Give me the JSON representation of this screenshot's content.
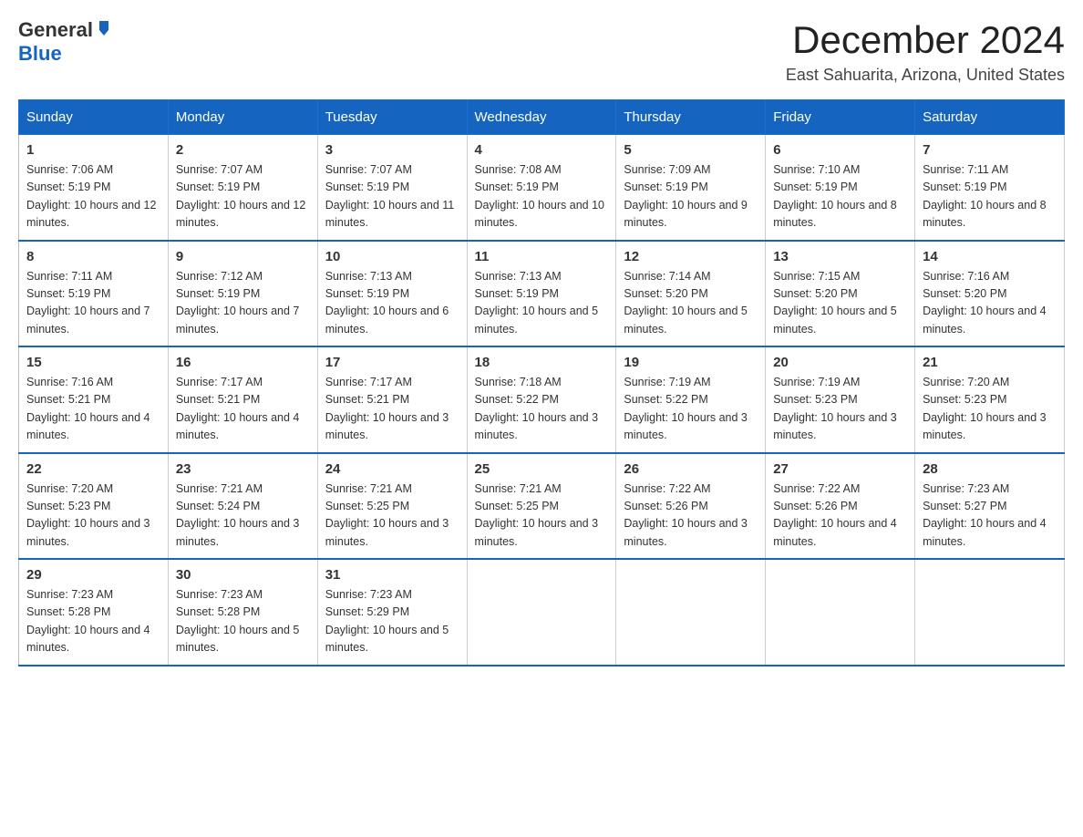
{
  "header": {
    "logo_general": "General",
    "logo_blue": "Blue",
    "title": "December 2024",
    "location": "East Sahuarita, Arizona, United States"
  },
  "days_of_week": [
    "Sunday",
    "Monday",
    "Tuesday",
    "Wednesday",
    "Thursday",
    "Friday",
    "Saturday"
  ],
  "weeks": [
    [
      {
        "day": "1",
        "sunrise": "7:06 AM",
        "sunset": "5:19 PM",
        "daylight": "10 hours and 12 minutes."
      },
      {
        "day": "2",
        "sunrise": "7:07 AM",
        "sunset": "5:19 PM",
        "daylight": "10 hours and 12 minutes."
      },
      {
        "day": "3",
        "sunrise": "7:07 AM",
        "sunset": "5:19 PM",
        "daylight": "10 hours and 11 minutes."
      },
      {
        "day": "4",
        "sunrise": "7:08 AM",
        "sunset": "5:19 PM",
        "daylight": "10 hours and 10 minutes."
      },
      {
        "day": "5",
        "sunrise": "7:09 AM",
        "sunset": "5:19 PM",
        "daylight": "10 hours and 9 minutes."
      },
      {
        "day": "6",
        "sunrise": "7:10 AM",
        "sunset": "5:19 PM",
        "daylight": "10 hours and 8 minutes."
      },
      {
        "day": "7",
        "sunrise": "7:11 AM",
        "sunset": "5:19 PM",
        "daylight": "10 hours and 8 minutes."
      }
    ],
    [
      {
        "day": "8",
        "sunrise": "7:11 AM",
        "sunset": "5:19 PM",
        "daylight": "10 hours and 7 minutes."
      },
      {
        "day": "9",
        "sunrise": "7:12 AM",
        "sunset": "5:19 PM",
        "daylight": "10 hours and 7 minutes."
      },
      {
        "day": "10",
        "sunrise": "7:13 AM",
        "sunset": "5:19 PM",
        "daylight": "10 hours and 6 minutes."
      },
      {
        "day": "11",
        "sunrise": "7:13 AM",
        "sunset": "5:19 PM",
        "daylight": "10 hours and 5 minutes."
      },
      {
        "day": "12",
        "sunrise": "7:14 AM",
        "sunset": "5:20 PM",
        "daylight": "10 hours and 5 minutes."
      },
      {
        "day": "13",
        "sunrise": "7:15 AM",
        "sunset": "5:20 PM",
        "daylight": "10 hours and 5 minutes."
      },
      {
        "day": "14",
        "sunrise": "7:16 AM",
        "sunset": "5:20 PM",
        "daylight": "10 hours and 4 minutes."
      }
    ],
    [
      {
        "day": "15",
        "sunrise": "7:16 AM",
        "sunset": "5:21 PM",
        "daylight": "10 hours and 4 minutes."
      },
      {
        "day": "16",
        "sunrise": "7:17 AM",
        "sunset": "5:21 PM",
        "daylight": "10 hours and 4 minutes."
      },
      {
        "day": "17",
        "sunrise": "7:17 AM",
        "sunset": "5:21 PM",
        "daylight": "10 hours and 3 minutes."
      },
      {
        "day": "18",
        "sunrise": "7:18 AM",
        "sunset": "5:22 PM",
        "daylight": "10 hours and 3 minutes."
      },
      {
        "day": "19",
        "sunrise": "7:19 AM",
        "sunset": "5:22 PM",
        "daylight": "10 hours and 3 minutes."
      },
      {
        "day": "20",
        "sunrise": "7:19 AM",
        "sunset": "5:23 PM",
        "daylight": "10 hours and 3 minutes."
      },
      {
        "day": "21",
        "sunrise": "7:20 AM",
        "sunset": "5:23 PM",
        "daylight": "10 hours and 3 minutes."
      }
    ],
    [
      {
        "day": "22",
        "sunrise": "7:20 AM",
        "sunset": "5:23 PM",
        "daylight": "10 hours and 3 minutes."
      },
      {
        "day": "23",
        "sunrise": "7:21 AM",
        "sunset": "5:24 PM",
        "daylight": "10 hours and 3 minutes."
      },
      {
        "day": "24",
        "sunrise": "7:21 AM",
        "sunset": "5:25 PM",
        "daylight": "10 hours and 3 minutes."
      },
      {
        "day": "25",
        "sunrise": "7:21 AM",
        "sunset": "5:25 PM",
        "daylight": "10 hours and 3 minutes."
      },
      {
        "day": "26",
        "sunrise": "7:22 AM",
        "sunset": "5:26 PM",
        "daylight": "10 hours and 3 minutes."
      },
      {
        "day": "27",
        "sunrise": "7:22 AM",
        "sunset": "5:26 PM",
        "daylight": "10 hours and 4 minutes."
      },
      {
        "day": "28",
        "sunrise": "7:23 AM",
        "sunset": "5:27 PM",
        "daylight": "10 hours and 4 minutes."
      }
    ],
    [
      {
        "day": "29",
        "sunrise": "7:23 AM",
        "sunset": "5:28 PM",
        "daylight": "10 hours and 4 minutes."
      },
      {
        "day": "30",
        "sunrise": "7:23 AM",
        "sunset": "5:28 PM",
        "daylight": "10 hours and 5 minutes."
      },
      {
        "day": "31",
        "sunrise": "7:23 AM",
        "sunset": "5:29 PM",
        "daylight": "10 hours and 5 minutes."
      },
      null,
      null,
      null,
      null
    ]
  ],
  "labels": {
    "sunrise_prefix": "Sunrise: ",
    "sunset_prefix": "Sunset: ",
    "daylight_prefix": "Daylight: "
  }
}
